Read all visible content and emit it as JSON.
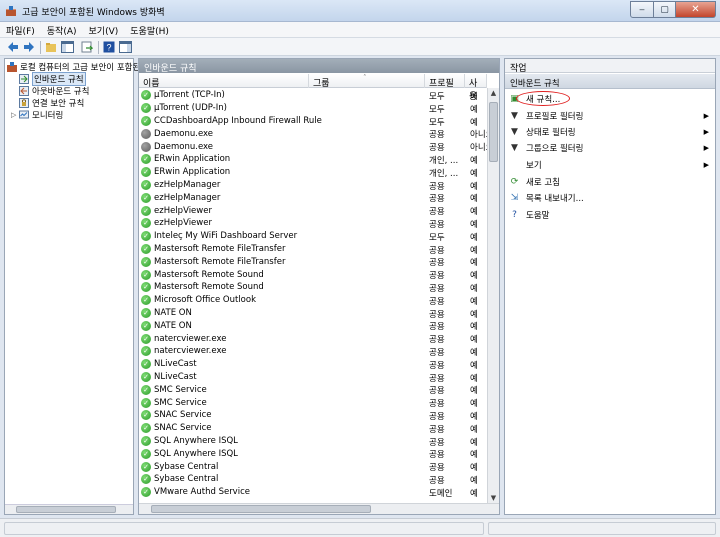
{
  "window": {
    "title": "고급 보안이 포함된 Windows 방화벽",
    "min_glyph": "‒",
    "max_glyph": "▢",
    "close_glyph": "✕"
  },
  "menu": [
    "파일(F)",
    "동작(A)",
    "보기(V)",
    "도움말(H)"
  ],
  "tree": {
    "root": "로컬 컴퓨터의 고급 보안이 포함된",
    "items": [
      {
        "label": "인바운드 규칙",
        "selected": true
      },
      {
        "label": "아웃바운드 규칙",
        "selected": false
      },
      {
        "label": "연결 보안 규칙",
        "selected": false
      },
      {
        "label": "모니터링",
        "selected": false
      }
    ]
  },
  "center": {
    "title": "인바운드 규칙",
    "columns": {
      "name": "이름",
      "group": "그룹",
      "profile": "프로필",
      "enabled": "사용"
    },
    "rows": [
      {
        "name": "µTorrent (TCP-In)",
        "profile": "모두",
        "enabled": "예",
        "on": true
      },
      {
        "name": "µTorrent (UDP-In)",
        "profile": "모두",
        "enabled": "예",
        "on": true
      },
      {
        "name": "CCDashboardApp Inbound Firewall Rule",
        "profile": "모두",
        "enabled": "예",
        "on": true
      },
      {
        "name": "Daemonu.exe",
        "profile": "공용",
        "enabled": "아니요",
        "on": false
      },
      {
        "name": "Daemonu.exe",
        "profile": "공용",
        "enabled": "아니요",
        "on": false
      },
      {
        "name": "ERwin Application",
        "profile": "개인, ...",
        "enabled": "예",
        "on": true
      },
      {
        "name": "ERwin Application",
        "profile": "개인, ...",
        "enabled": "예",
        "on": true
      },
      {
        "name": "ezHelpManager",
        "profile": "공용",
        "enabled": "예",
        "on": true
      },
      {
        "name": "ezHelpManager",
        "profile": "공용",
        "enabled": "예",
        "on": true
      },
      {
        "name": "ezHelpViewer",
        "profile": "공용",
        "enabled": "예",
        "on": true
      },
      {
        "name": "ezHelpViewer",
        "profile": "공용",
        "enabled": "예",
        "on": true
      },
      {
        "name": "Inteleç My WiFi Dashboard Server",
        "profile": "모두",
        "enabled": "예",
        "on": true
      },
      {
        "name": "Mastersoft Remote FileTransfer",
        "profile": "공용",
        "enabled": "예",
        "on": true
      },
      {
        "name": "Mastersoft Remote FileTransfer",
        "profile": "공용",
        "enabled": "예",
        "on": true
      },
      {
        "name": "Mastersoft Remote Sound",
        "profile": "공용",
        "enabled": "예",
        "on": true
      },
      {
        "name": "Mastersoft Remote Sound",
        "profile": "공용",
        "enabled": "예",
        "on": true
      },
      {
        "name": "Microsoft Office Outlook",
        "profile": "공용",
        "enabled": "예",
        "on": true
      },
      {
        "name": "NATE ON",
        "profile": "공용",
        "enabled": "예",
        "on": true
      },
      {
        "name": "NATE ON",
        "profile": "공용",
        "enabled": "예",
        "on": true
      },
      {
        "name": "natercviewer.exe",
        "profile": "공용",
        "enabled": "예",
        "on": true
      },
      {
        "name": "natercviewer.exe",
        "profile": "공용",
        "enabled": "예",
        "on": true
      },
      {
        "name": "NLiveCast",
        "profile": "공용",
        "enabled": "예",
        "on": true
      },
      {
        "name": "NLiveCast",
        "profile": "공용",
        "enabled": "예",
        "on": true
      },
      {
        "name": "SMC Service",
        "profile": "공용",
        "enabled": "예",
        "on": true
      },
      {
        "name": "SMC Service",
        "profile": "공용",
        "enabled": "예",
        "on": true
      },
      {
        "name": "SNAC Service",
        "profile": "공용",
        "enabled": "예",
        "on": true
      },
      {
        "name": "SNAC Service",
        "profile": "공용",
        "enabled": "예",
        "on": true
      },
      {
        "name": "SQL Anywhere ISQL",
        "profile": "공용",
        "enabled": "예",
        "on": true
      },
      {
        "name": "SQL Anywhere ISQL",
        "profile": "공용",
        "enabled": "예",
        "on": true
      },
      {
        "name": "Sybase Central",
        "profile": "공용",
        "enabled": "예",
        "on": true
      },
      {
        "name": "Sybase Central",
        "profile": "공용",
        "enabled": "예",
        "on": true
      },
      {
        "name": "VMware Authd Service",
        "profile": "도메인",
        "enabled": "예",
        "on": true
      }
    ]
  },
  "actions": {
    "title": "작업",
    "section": "인바운드 규칙",
    "items": [
      {
        "label": "새 규칙...",
        "icon": "new-rule-icon",
        "glyph": "▣",
        "color": "#2f8a2f",
        "submenu": false
      },
      {
        "label": "프로필로 필터링",
        "icon": "filter-icon",
        "glyph": "▼",
        "color": "#333333",
        "submenu": true
      },
      {
        "label": "상태로 필터링",
        "icon": "filter-icon",
        "glyph": "▼",
        "color": "#333333",
        "submenu": true
      },
      {
        "label": "그룹으로 필터링",
        "icon": "filter-icon",
        "glyph": "▼",
        "color": "#333333",
        "submenu": true
      },
      {
        "label": "보기",
        "icon": "",
        "glyph": "",
        "color": "#333333",
        "submenu": true
      },
      {
        "label": "새로 고침",
        "icon": "refresh-icon",
        "glyph": "⟳",
        "color": "#2f8a2f",
        "submenu": false
      },
      {
        "label": "목록 내보내기...",
        "icon": "export-icon",
        "glyph": "⇲",
        "color": "#2f6fb0",
        "submenu": false
      },
      {
        "label": "도움말",
        "icon": "help-icon",
        "glyph": "?",
        "color": "#1f4fa0",
        "submenu": false
      }
    ]
  }
}
